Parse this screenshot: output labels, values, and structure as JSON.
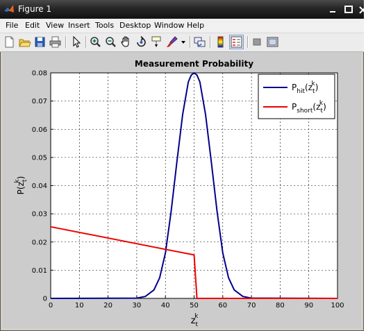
{
  "window": {
    "title": "Figure 1",
    "controls": [
      "minimize",
      "maximize",
      "close"
    ]
  },
  "menu": {
    "items": [
      "File",
      "Edit",
      "View",
      "Insert",
      "Tools",
      "Desktop",
      "Window",
      "Help"
    ]
  },
  "toolbar": {
    "buttons": [
      "new-figure-icon",
      "open-file-icon",
      "save-icon",
      "print-icon",
      "edit-plot-icon",
      "zoom-in-icon",
      "zoom-out-icon",
      "pan-hand-icon",
      "rotate-3d-icon",
      "data-cursor-icon",
      "brush-icon",
      "brush-dropdown-icon",
      "link-plot-icon",
      "colorbar-icon",
      "legend-icon",
      "hide-plot-tools-icon",
      "show-plot-tools-icon"
    ]
  },
  "chart_data": {
    "type": "line",
    "title": "Measurement Probability",
    "xlabel": "z_t^k",
    "ylabel": "P(z_t^k)",
    "xlim": [
      0,
      100
    ],
    "ylim": [
      0,
      0.08
    ],
    "xticks": [
      "0",
      "10",
      "20",
      "30",
      "40",
      "50",
      "60",
      "70",
      "80",
      "90",
      "100"
    ],
    "yticks": [
      "0",
      "0.01",
      "0.02",
      "0.03",
      "0.04",
      "0.05",
      "0.06",
      "0.07",
      "0.08"
    ],
    "grid": true,
    "legend_position": "top-right",
    "series": [
      {
        "name": "P_hit(z_t^k)",
        "color": "#00008b",
        "x": [
          0,
          30,
          33,
          36,
          38,
          40,
          42,
          44,
          46,
          48,
          49,
          50,
          51,
          52,
          54,
          56,
          58,
          60,
          62,
          64,
          67,
          70,
          100
        ],
        "y": [
          0,
          0.0001,
          0.0007,
          0.003,
          0.0073,
          0.0161,
          0.031,
          0.0484,
          0.0652,
          0.0768,
          0.0792,
          0.08,
          0.0792,
          0.0768,
          0.0652,
          0.0484,
          0.031,
          0.0161,
          0.0073,
          0.003,
          0.0007,
          0.0001,
          0
        ]
      },
      {
        "name": "P_short(z_t^k)",
        "color": "#ee0000",
        "x": [
          0,
          50,
          50,
          51,
          100
        ],
        "y": [
          0.0254,
          0.0154,
          0.0154,
          0,
          0
        ]
      }
    ]
  }
}
